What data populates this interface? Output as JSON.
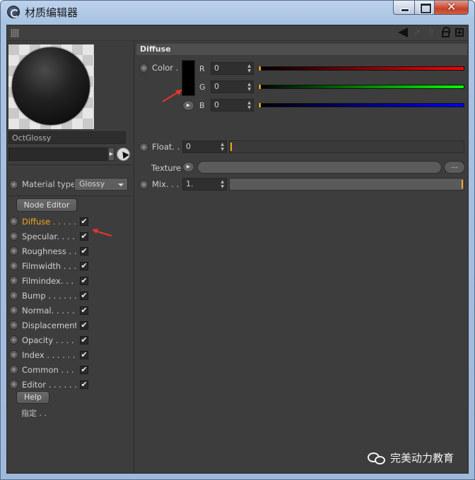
{
  "window": {
    "title": "材质编辑器",
    "close_glyph": "✕"
  },
  "toolbar": {
    "icons": [
      "grip-icon",
      "back-arrow-icon",
      "forward-arrow-icon",
      "up-arrow-icon",
      "lock-icon",
      "new-panel-icon"
    ]
  },
  "material": {
    "name": "OctGlossy",
    "link_value": "",
    "type_label": "Material type",
    "type_value": "Glossy"
  },
  "buttons": {
    "node_editor": "Node Editor",
    "help": "Help",
    "texture_more": "..."
  },
  "channels": [
    {
      "label": "Diffuse . . . . .",
      "checked": true,
      "active": true
    },
    {
      "label": "Specular. . . . .",
      "checked": true
    },
    {
      "label": "Roughness . .",
      "checked": true
    },
    {
      "label": "Filmwidth . . .",
      "checked": true
    },
    {
      "label": "Filmindex. . . .",
      "checked": true
    },
    {
      "label": "Bump . . . . . . .",
      "checked": true
    },
    {
      "label": "Normal. . . . . .",
      "checked": true
    },
    {
      "label": "Displacement",
      "checked": true
    },
    {
      "label": "Opacity . . . . .",
      "checked": true
    },
    {
      "label": "Index . . . . . . .",
      "checked": true
    },
    {
      "label": "Common . . . .",
      "checked": true
    },
    {
      "label": "Editor . . . . . . .",
      "checked": true
    }
  ],
  "check_glyph": "✔",
  "assign_label": "指定 . .",
  "diffuse": {
    "section_title": "Diffuse",
    "color_label": "Color .",
    "color_value": "#000000",
    "r_label": "R",
    "r_value": "0",
    "g_label": "G",
    "g_value": "0",
    "b_label": "B",
    "b_value": "0",
    "float_label": "Float. .",
    "float_value": "0",
    "texture_label": "Texture",
    "mix_label": "Mix. . .",
    "mix_value": "1."
  },
  "colors": {
    "accent": "#f1a51e",
    "red": "#ff0000",
    "green": "#00ff00",
    "blue": "#0000ff",
    "annotation": "#e8352a"
  },
  "watermark": {
    "text": "完美动力教育"
  }
}
